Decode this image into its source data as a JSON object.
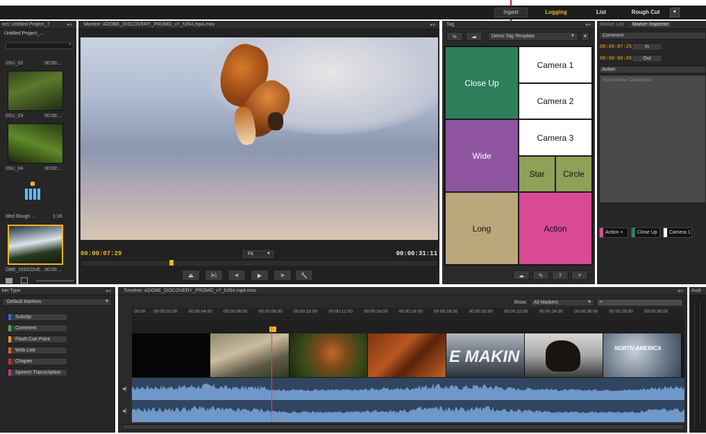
{
  "workspace_tabs": [
    "Ingest",
    "Logging",
    "List",
    "Rough Cut"
  ],
  "project_panel": {
    "tab": "ect: Untitled Project_7",
    "name": "Untitled Project_...",
    "clips": [
      {
        "name": "0SU_02",
        "time": "00:00:..."
      },
      {
        "name": "0SU_03",
        "time": "00:00:..."
      },
      {
        "name": "0SU_04",
        "time": "00:00:..."
      },
      {
        "name": "itled Rough ...",
        "time": "1:16"
      },
      {
        "name": "OBE_DISCOVE...",
        "time": "00:00:..."
      }
    ]
  },
  "monitor": {
    "tab": "Monitor: ADOBE_DISCOVERY_PROMO_v7_h264.mp4.mov",
    "current_time": "00:00:07:29",
    "duration": "00:00:31:11",
    "zoom": "Fit",
    "playhead_fraction": 0.25
  },
  "tag_panel": {
    "tab": "Tag",
    "template": "Demo Tag Template",
    "tiles": [
      {
        "label": "Close Up",
        "color": "#2e7f5c"
      },
      {
        "label": "Camera 1",
        "color": "#ffffff"
      },
      {
        "label": "Camera 2",
        "color": "#ffffff"
      },
      {
        "label": "Wide",
        "color": "#8e54a0"
      },
      {
        "label": "Camera 3",
        "color": "#ffffff"
      },
      {
        "label": "Star",
        "color": "#8fa058"
      },
      {
        "label": "Circle",
        "color": "#8fa058"
      },
      {
        "label": "Long",
        "color": "#bca67c"
      },
      {
        "label": "Action",
        "color": "#d94a96"
      }
    ]
  },
  "marker_inspector": {
    "tabs": [
      "Marker List",
      "Marker Inspector"
    ],
    "type": "Comment",
    "in_time": "00:00:07:25",
    "in_label": "In",
    "out_time": "00:00:08:05",
    "out_label": "Out",
    "name": "Action",
    "description_placeholder": "Input Marker Description",
    "chips": [
      {
        "label": "Action",
        "color": "#d94a96"
      },
      {
        "label": "Close Up",
        "color": "#2e7f5c"
      },
      {
        "label": "Camera 1",
        "color": "#ffffff"
      }
    ]
  },
  "marker_type_panel": {
    "tab": "ker Type",
    "preset": "Default Markers",
    "types": [
      {
        "label": "Subclip",
        "color": "#3a6fc4"
      },
      {
        "label": "Comment",
        "color": "#4caa4c"
      },
      {
        "label": "Flash Cue Point",
        "color": "#e0a020"
      },
      {
        "label": "Web Link",
        "color": "#e06020"
      },
      {
        "label": "Chapter",
        "color": "#d02c2c"
      },
      {
        "label": "Speech Transcription",
        "color": "#c03a8a"
      }
    ]
  },
  "timeline": {
    "tab": "Timeline: ADOBE_DISCOVERY_PROMO_v7_h264.mp4.mov",
    "show_label": "Show:",
    "show_value": "All Markers",
    "ticks": [
      "00:00",
      "00:00:02:00",
      "00:00:04:00",
      "00:00:06:00",
      "00:00:08:00",
      "00:00:10:00",
      "00:00:12:00",
      "00:00:14:00",
      "00:00:16:00",
      "00:00:18:00",
      "00:00:20:00",
      "00:00:22:00",
      "00:00:24:00",
      "00:00:26:00",
      "00:00:28:00",
      "00:00:30:00"
    ],
    "clip_overlay_texts": [
      "E MAKIN",
      "NORTH AMERICA"
    ]
  },
  "audio_panel": {
    "tab": "Audi"
  },
  "colors": {
    "accent": "#f2b51c",
    "playhead": "#ff3b3b",
    "audio_wave": "#6f97c8"
  }
}
